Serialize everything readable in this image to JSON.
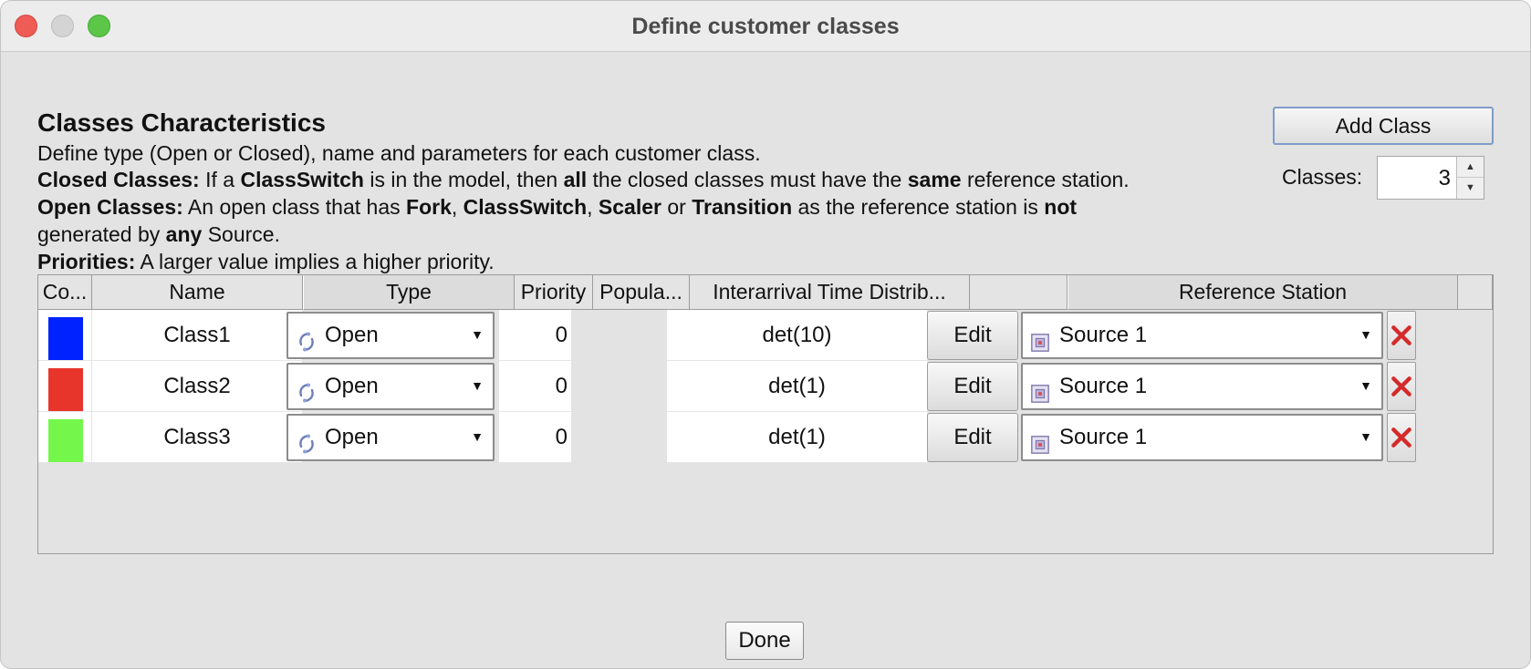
{
  "window": {
    "title": "Define customer classes"
  },
  "panel": {
    "heading": "Classes Characteristics",
    "line1": "Define type (Open or Closed), name and parameters for each customer class.",
    "line2": {
      "b1": "Closed Classes:",
      "t1": " If a ",
      "b2": "ClassSwitch",
      "t2": " is in the model, then ",
      "b3": "all",
      "t3": " the closed classes must have the ",
      "b4": "same",
      "t4": " reference station."
    },
    "line3": {
      "b1": "Open Classes:",
      "t1": " An open class that has ",
      "b2": "Fork",
      "t2": ", ",
      "b3": "ClassSwitch",
      "t3": ", ",
      "b4": "Scaler",
      "t4": " or ",
      "b5": "Transition",
      "t5": " as the reference station is ",
      "b6": "not"
    },
    "line4": {
      "t1": "generated by ",
      "b1": "any",
      "t2": " Source."
    },
    "line5": {
      "b1": "Priorities:",
      "t1": " A larger value implies a higher priority."
    }
  },
  "controls": {
    "add_class_label": "Add Class",
    "classes_label": "Classes:",
    "classes_count": "3",
    "done_label": "Done"
  },
  "table": {
    "headers": {
      "color": "Co...",
      "name": "Name",
      "type": "Type",
      "priority": "Priority",
      "population": "Popula...",
      "distribution": "Interarrival Time Distrib...",
      "edit": "",
      "reference": "Reference Station",
      "delete": ""
    },
    "rows": [
      {
        "color": "#0022ff",
        "name": "Class1",
        "type": "Open",
        "priority": "0",
        "population": "",
        "distribution": "det(10)",
        "edit_label": "Edit",
        "reference": "Source 1"
      },
      {
        "color": "#e8352b",
        "name": "Class2",
        "type": "Open",
        "priority": "0",
        "population": "",
        "distribution": "det(1)",
        "edit_label": "Edit",
        "reference": "Source 1"
      },
      {
        "color": "#74f74a",
        "name": "Class3",
        "type": "Open",
        "priority": "0",
        "population": "",
        "distribution": "det(1)",
        "edit_label": "Edit",
        "reference": "Source 1"
      }
    ]
  },
  "icons": {
    "open_type": "open-class-icon",
    "source": "source-station-icon",
    "delete": "delete-x-icon",
    "dropdown": "chevron-down-icon"
  }
}
